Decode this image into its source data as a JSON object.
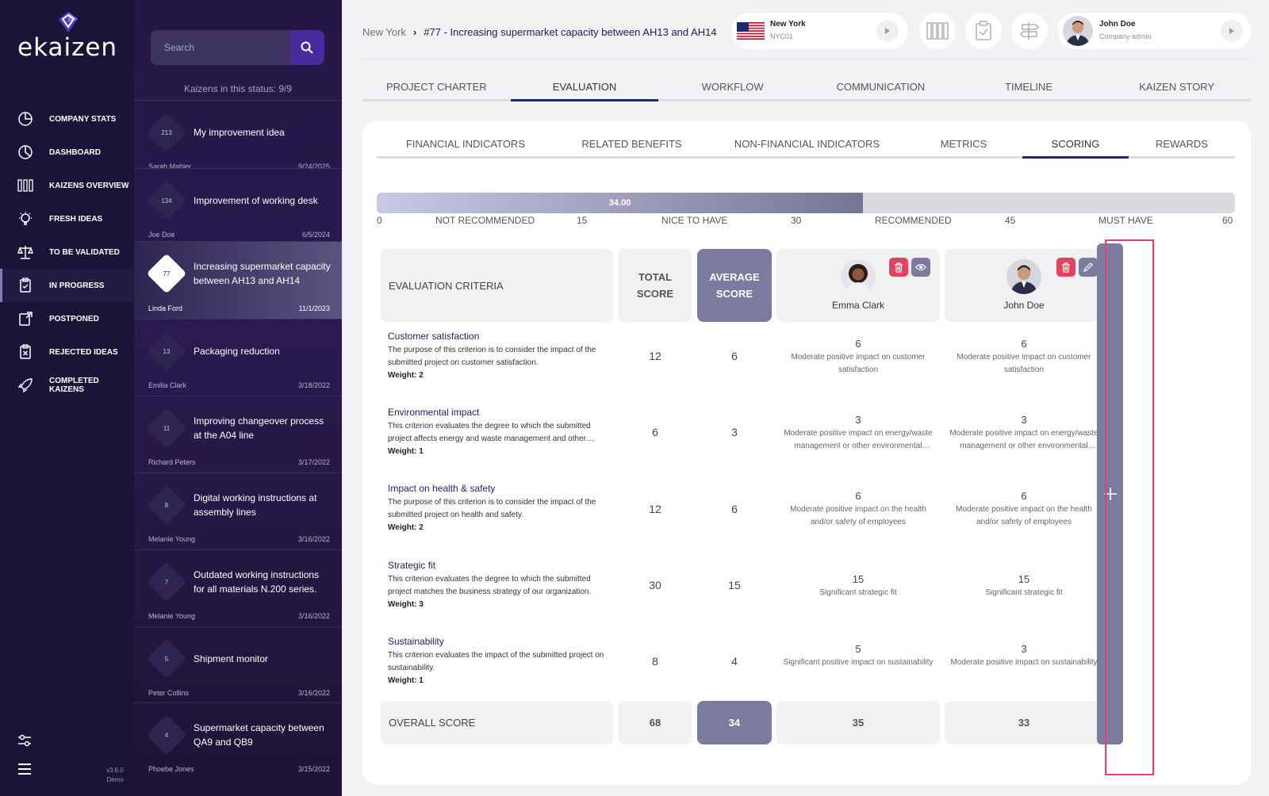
{
  "app": {
    "name": "ekaizen",
    "version": "v3.6.0",
    "edition": "Demo"
  },
  "nav": {
    "items": [
      {
        "label": "COMPANY STATS"
      },
      {
        "label": "DASHBOARD"
      },
      {
        "label": "KAIZENS OVERVIEW"
      },
      {
        "label": "FRESH IDEAS"
      },
      {
        "label": "TO BE VALIDATED"
      },
      {
        "label": "IN PROGRESS"
      },
      {
        "label": "POSTPONED"
      },
      {
        "label": "REJECTED IDEAS"
      },
      {
        "label": "COMPLETED KAIZENS"
      }
    ]
  },
  "list": {
    "search_placeholder": "Search",
    "status_count": "Kaizens in this status: 9/9",
    "items": [
      {
        "num": "213",
        "title": "My improvement idea",
        "author": "Sarah Mahler",
        "date": "9/24/2025"
      },
      {
        "num": "134",
        "title": "Improvement of working desk",
        "author": "Joe Doe",
        "date": "6/5/2024"
      },
      {
        "num": "77",
        "title": "Increasing supermarket capacity between AH13 and AH14",
        "author": "Linda Ford",
        "date": "11/1/2023"
      },
      {
        "num": "13",
        "title": "Packaging reduction",
        "author": "Emilia Clark",
        "date": "3/18/2022"
      },
      {
        "num": "11",
        "title": "Improving changeover process at the A04 line",
        "author": "Richard Peters",
        "date": "3/17/2022"
      },
      {
        "num": "8",
        "title": "Digital working instructions at assembly lines",
        "author": "Melanie Young",
        "date": "3/16/2022"
      },
      {
        "num": "7",
        "title": "Outdated working instructions for all materials N.200 series.",
        "author": "Melanie Young",
        "date": "3/16/2022"
      },
      {
        "num": "5",
        "title": "Shipment monitor",
        "author": "Peter Collins",
        "date": "3/16/2022"
      },
      {
        "num": "4",
        "title": "Supermarket capacity between QA9 and QB9",
        "author": "Phoebe Jones",
        "date": "3/15/2022"
      }
    ]
  },
  "header": {
    "breadcrumb_root": "New York",
    "breadcrumb_current": "#77 - Increasing supermarket capacity between AH13 and AH14",
    "location_name": "New York",
    "location_code": "NYC01",
    "user_name": "John Doe",
    "user_role": "Company admin"
  },
  "tabs": [
    "PROJECT CHARTER",
    "EVALUATION",
    "WORKFLOW",
    "COMMUNICATION",
    "TIMELINE",
    "KAIZEN STORY"
  ],
  "subtabs": [
    "FINANCIAL INDICATORS",
    "RELATED BENEFITS",
    "NON-FINANCIAL INDICATORS",
    "METRICS",
    "SCORING",
    "REWARDS"
  ],
  "scoring_bar": {
    "value": 34,
    "value_label": "34.00",
    "max": 60,
    "ticks": [
      "0",
      "15",
      "30",
      "45",
      "60"
    ],
    "zones": [
      "NOT RECOMMENDED",
      "NICE TO HAVE",
      "RECOMMENDED",
      "MUST HAVE"
    ]
  },
  "table": {
    "header": {
      "criteria": "EVALUATION CRITERIA",
      "total": "TOTAL SCORE",
      "average": "AVERAGE SCORE"
    },
    "evaluators": [
      {
        "name": "Emma Clark"
      },
      {
        "name": "John Doe"
      }
    ],
    "rows": [
      {
        "title": "Customer satisfaction",
        "desc": "The purpose of this criterion is to consider the impact of the submitted project on customer satisfaction.",
        "weight": "Weight: 2",
        "total": "12",
        "avg": "6",
        "scores": [
          {
            "s": "6",
            "d": "Moderate positive impact on customer satisfaction"
          },
          {
            "s": "6",
            "d": "Moderate positive impact on customer satisfaction"
          }
        ]
      },
      {
        "title": "Environmental impact",
        "desc": "This criterion evaluates the degree to which the submitted project affects energy and waste management and other environmental aspects.",
        "weight": "Weight: 1",
        "total": "6",
        "avg": "3",
        "scores": [
          {
            "s": "3",
            "d": "Moderate positive impact on energy/waste management or other environmental aspects"
          },
          {
            "s": "3",
            "d": "Moderate positive impact on energy/waste management or other environmental aspects"
          }
        ]
      },
      {
        "title": "Impact on health & safety",
        "desc": "The purpose of this criterion is to consider the impact of the submitted project on health and safety.",
        "weight": "Weight: 2",
        "total": "12",
        "avg": "6",
        "scores": [
          {
            "s": "6",
            "d": "Moderate positive impact on the health and/or safety of employees"
          },
          {
            "s": "6",
            "d": "Moderate positive impact on the health and/or safety of employees"
          }
        ]
      },
      {
        "title": "Strategic fit",
        "desc": "This criterion evaluates the degree to which the submitted project matches the business strategy of our organization.",
        "weight": "Weight: 3",
        "total": "30",
        "avg": "15",
        "scores": [
          {
            "s": "15",
            "d": "Significant strategic fit"
          },
          {
            "s": "15",
            "d": "Significant strategic fit"
          }
        ]
      },
      {
        "title": "Sustainability",
        "desc": "This criterion evaluates the impact of the submitted project on sustainability.",
        "weight": "Weight: 1",
        "total": "8",
        "avg": "4",
        "scores": [
          {
            "s": "5",
            "d": "Significant positive impact on sustainability"
          },
          {
            "s": "3",
            "d": "Moderate positive impact on sustainability"
          }
        ]
      }
    ],
    "overall": {
      "label": "OVERALL SCORE",
      "total": "68",
      "avg": "34",
      "scores": [
        "35",
        "33"
      ]
    }
  },
  "colors": {
    "sidebar": "#1c1438",
    "accent": "#1f2680",
    "avg_cell": "#7b7ba0",
    "delete": "#e0435c",
    "highlight": "#ee3a77"
  }
}
